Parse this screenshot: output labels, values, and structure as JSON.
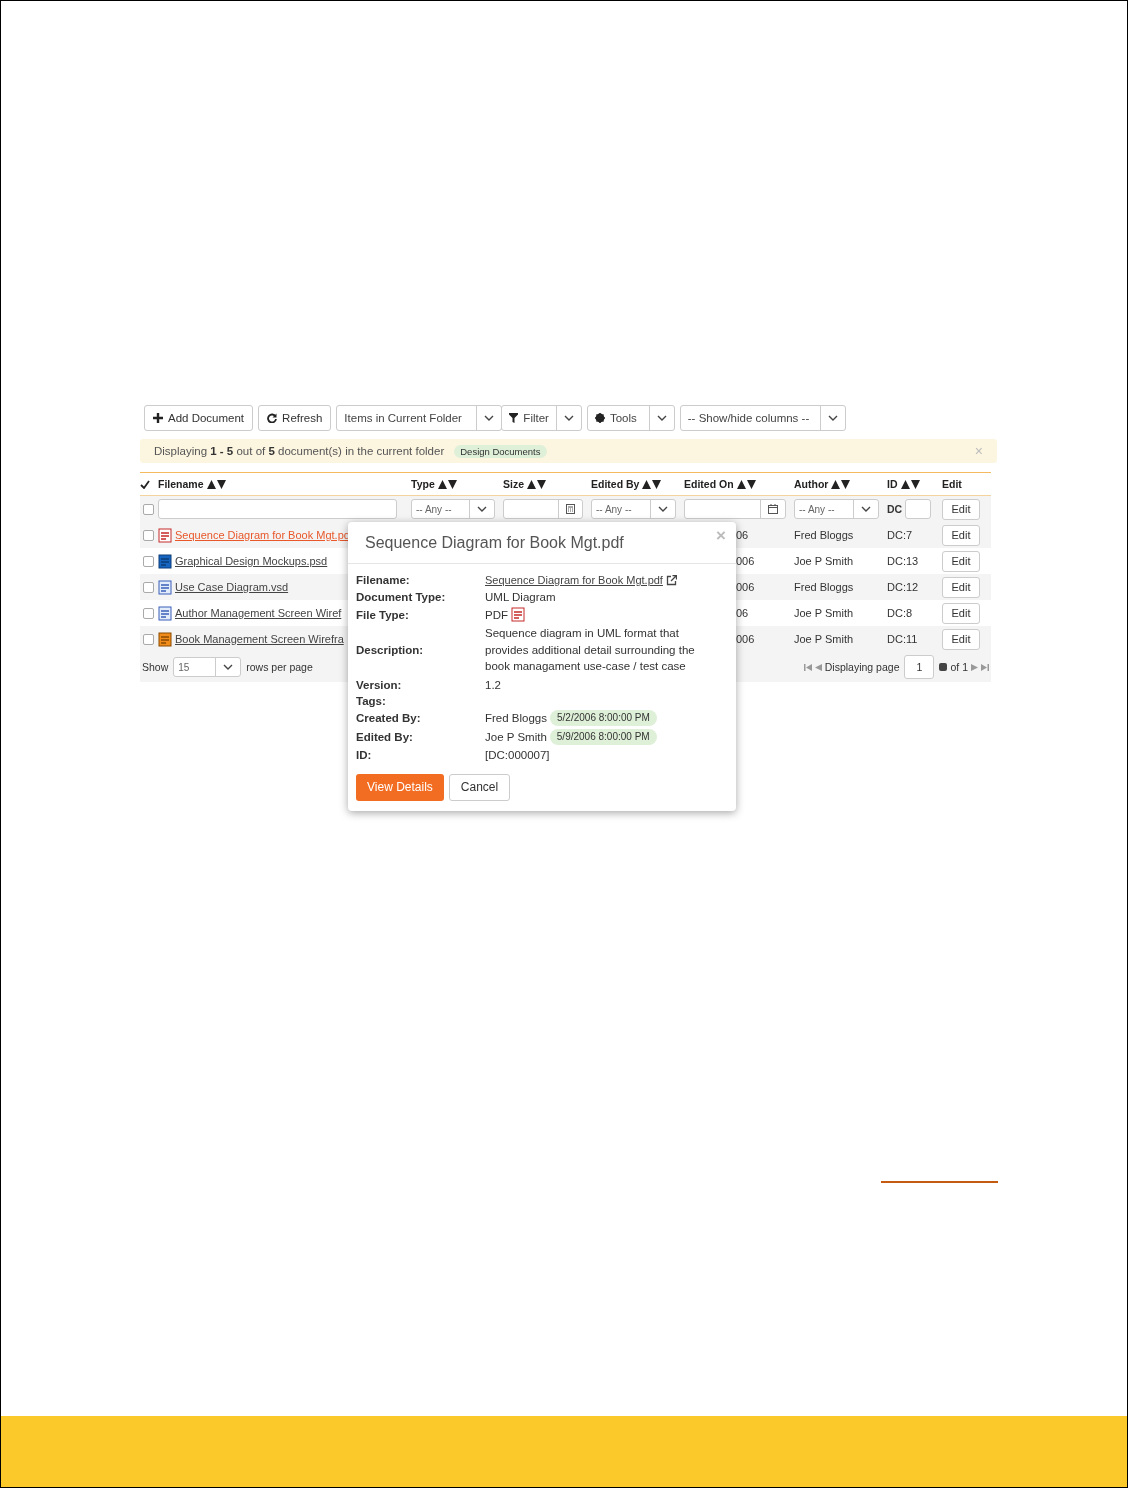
{
  "toolbar": {
    "add_document": "Add Document",
    "refresh": "Refresh",
    "scope": "Items in Current Folder",
    "filter": "Filter",
    "tools": "Tools",
    "columns": "-- Show/hide columns --"
  },
  "alert": {
    "text": "Displaying **1 - 5** out of **5** document(s) in the current folder",
    "tag": "Design Documents",
    "close": "×"
  },
  "table": {
    "columns": [
      {
        "label": "Filename",
        "kind": "check"
      },
      {
        "label": "Type",
        "kind": "sortable"
      },
      {
        "label": "Size",
        "kind": "sortable"
      },
      {
        "label": "Edited By",
        "kind": "sortable"
      },
      {
        "label": "Edited On",
        "kind": "sortable"
      },
      {
        "label": "Author",
        "kind": "sortable"
      },
      {
        "label": "ID",
        "kind": "sortable"
      },
      {
        "label": "Edit",
        "kind": "plain"
      }
    ],
    "filters": {
      "checked": false,
      "type": "-- Any --",
      "edited_by": "-- Any --",
      "author": "-- Any --",
      "id_prefix": "DC",
      "edit": "Edit"
    },
    "rows": [
      {
        "checked": false,
        "kind": "pdf",
        "filename": "Sequence Diagram for Book Mgt.pd",
        "highlighted": true,
        "edited_on": "06",
        "author": "Fred Bloggs",
        "id": "DC:7",
        "edit": "Edit"
      },
      {
        "checked": false,
        "kind": "psd",
        "filename": "Graphical Design Mockups.psd",
        "highlighted": false,
        "edited_on": "006",
        "author": "Joe P Smith",
        "id": "DC:13",
        "edit": "Edit"
      },
      {
        "checked": false,
        "kind": "vsd",
        "filename": "Use Case Diagram.vsd",
        "highlighted": false,
        "edited_on": "006",
        "author": "Fred Bloggs",
        "id": "DC:12",
        "edit": "Edit"
      },
      {
        "checked": false,
        "kind": "vsd",
        "filename": "Author Management Screen Wiref",
        "highlighted": false,
        "edited_on": "06",
        "author": "Joe P Smith",
        "id": "DC:8",
        "edit": "Edit"
      },
      {
        "checked": false,
        "kind": "ai",
        "filename": "Book Management Screen Wirefra",
        "highlighted": false,
        "edited_on": "006",
        "author": "Joe P Smith",
        "id": "DC:11",
        "edit": "Edit"
      }
    ],
    "footer": {
      "show": "Show",
      "rows_value": "15",
      "rows_label": "rows per page",
      "displaying": "Displaying page",
      "page": "1",
      "of": "of 1"
    }
  },
  "popup": {
    "title": "Sequence Diagram for Book Mgt.pdf",
    "close": "×",
    "fields": [
      {
        "label": "Filename:",
        "kind": "link",
        "value": "Sequence Diagram for Book Mgt.pdf"
      },
      {
        "label": "Document Type:",
        "kind": "text",
        "value": "UML Diagram"
      },
      {
        "label": "File Type:",
        "kind": "pdf",
        "value": "PDF"
      },
      {
        "label": "Description:",
        "kind": "text",
        "value": "Sequence diagram in UML format that provides additional detail surrounding the book managament use-case / test case"
      },
      {
        "label": "Version:",
        "kind": "text",
        "value": "1.2"
      },
      {
        "label": "Tags:",
        "kind": "empty"
      },
      {
        "label": "Created By:",
        "kind": "user",
        "value": "Fred Bloggs",
        "date": "5/2/2006 8:00:00 PM"
      },
      {
        "label": "Edited By:",
        "kind": "user",
        "value": "Joe P Smith",
        "date": "5/9/2006 8:00:00 PM"
      },
      {
        "label": "ID:",
        "kind": "text",
        "value": "[DC:000007]"
      }
    ],
    "primary": "View Details",
    "secondary": "Cancel"
  }
}
